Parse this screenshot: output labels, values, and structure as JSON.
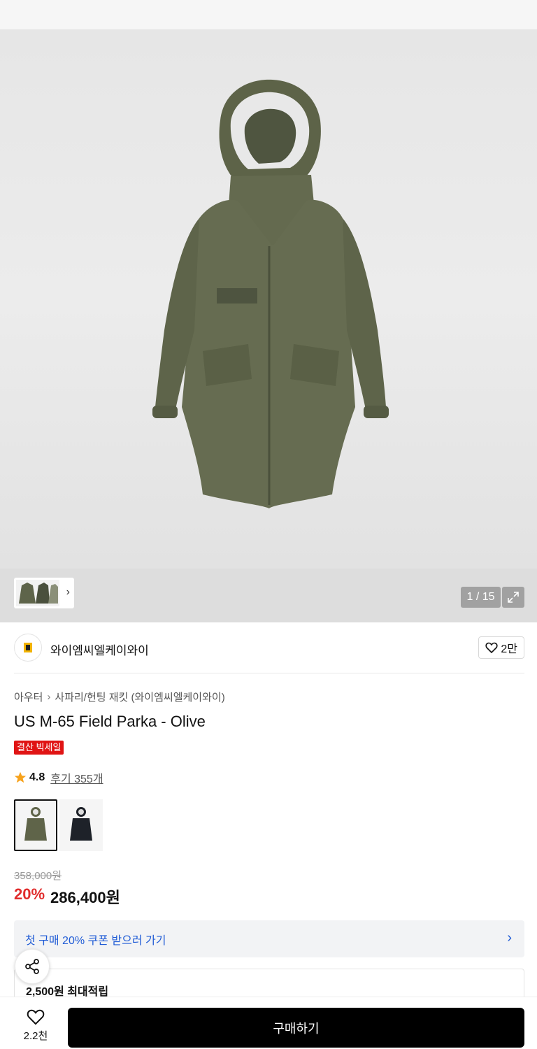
{
  "gallery": {
    "counter": "1 / 15",
    "thumbnail_icon": "parka-thumbnails",
    "expand_icon": "expand-icon"
  },
  "brand": {
    "name": "와이엠씨엘케이와이",
    "likes": "2만"
  },
  "breadcrumb": {
    "category": "아우터",
    "subcategory": "사파리/헌팅 재킷 (와이엠씨엘케이와이)"
  },
  "product": {
    "title": "US M-65 Field Parka - Olive",
    "badge": "결산 빅세일",
    "rating": "4.8",
    "reviews": "후기 355개",
    "rating_value": 4.8
  },
  "variants": [
    {
      "name": "olive",
      "color": "#5f6449"
    },
    {
      "name": "black",
      "color": "#1e2229"
    }
  ],
  "price": {
    "original": "358,000원",
    "discount": "20%",
    "final": "286,400원"
  },
  "coupon": {
    "text": "첫 구매 20% 쿠폰 받으러 가기"
  },
  "points": {
    "text": "2,500원 최대적립"
  },
  "bottom": {
    "wish_count": "2.2천",
    "buy_label": "구매하기"
  },
  "colors": {
    "accent_red": "#e12c2c",
    "coupon_blue": "#1f5bd6",
    "badge_red": "#e01414",
    "buy_bg": "#000000"
  }
}
